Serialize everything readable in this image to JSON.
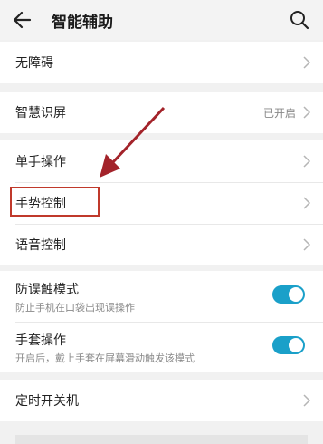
{
  "header": {
    "title": "智能辅助",
    "back_icon": "arrow-left-icon",
    "search_icon": "search-icon"
  },
  "items": [
    {
      "label": "无障碍"
    },
    {
      "label": "智慧识屏",
      "value": "已开启"
    },
    {
      "label": "单手操作"
    },
    {
      "label": "手势控制"
    },
    {
      "label": "语音控制"
    },
    {
      "label": "防误触模式",
      "sub": "防止手机在口袋出现误操作",
      "on": true
    },
    {
      "label": "手套操作",
      "sub": "开启后，戴上手套在屏幕滑动触发该模式",
      "on": true
    },
    {
      "label": "定时开关机"
    }
  ],
  "colors": {
    "accent": "#1aa0c9",
    "annotation": "#a3232a"
  }
}
